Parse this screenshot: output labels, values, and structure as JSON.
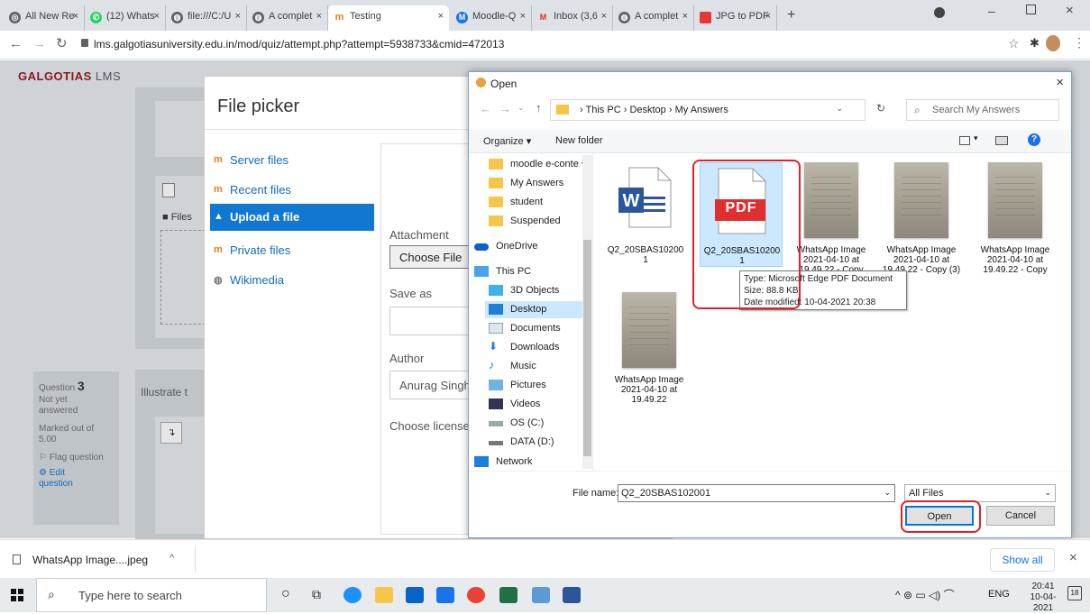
{
  "browser": {
    "tabs": [
      {
        "label": "All New Re",
        "icon": "chrome-icon",
        "color": "#5f6368"
      },
      {
        "label": "(12) Whats",
        "icon": "whatsapp-icon",
        "badge": "12",
        "color": "#25d366"
      },
      {
        "label": "file:///C:/U",
        "icon": "globe-icon",
        "color": "#5f6368"
      },
      {
        "label": "A complet",
        "icon": "globe-icon",
        "color": "#5f6368"
      },
      {
        "label": "Testing",
        "icon": "moodle-icon",
        "color": "#e77c1a",
        "active": true
      },
      {
        "label": "Moodle-Q",
        "icon": "moodle-icon",
        "color": "#1a73e8"
      },
      {
        "label": "Inbox (3,6",
        "icon": "gmail-icon",
        "color": "#d93025"
      },
      {
        "label": "A complet",
        "icon": "globe-icon",
        "color": "#5f6368"
      },
      {
        "label": "JPG to PDF",
        "icon": "jpg2pdf-icon",
        "color": "#e53935"
      }
    ],
    "address": "lms.galgotiasuniversity.edu.in/mod/quiz/attempt.php?attempt=5938733&cmid=472013"
  },
  "lms": {
    "logo_main": "GALGOTIAS",
    "logo_sub": "LMS",
    "files_label": "Files",
    "illustrate": "Illustrate t",
    "question": {
      "prefix": "Question",
      "number": "3",
      "status": "Not yet answered",
      "marked": "Marked out of 5.00",
      "flag": "Flag question",
      "edit": "Edit question"
    }
  },
  "file_picker": {
    "title": "File picker",
    "repos": [
      {
        "label": "Server files"
      },
      {
        "label": "Recent files"
      },
      {
        "label": "Upload a file",
        "active": true
      },
      {
        "label": "Private files"
      },
      {
        "label": "Wikimedia"
      }
    ],
    "attachment_label": "Attachment",
    "choose_file": "Choose File",
    "save_as_label": "Save as",
    "author_label": "Author",
    "author_value": "Anurag Singh",
    "license_label": "Choose license"
  },
  "dialog": {
    "title": "Open",
    "path": [
      "This PC",
      "Desktop",
      "My Answers"
    ],
    "search_placeholder": "Search My Answers",
    "organize": "Organize",
    "new_folder": "New folder",
    "nav_items": [
      {
        "label": "moodle e-conte",
        "icon": "folder-icon"
      },
      {
        "label": "My Answers",
        "icon": "folder-icon"
      },
      {
        "label": "student",
        "icon": "folder-icon"
      },
      {
        "label": "Suspended",
        "icon": "folder-icon"
      },
      {
        "label": "OneDrive",
        "icon": "cloud-icon"
      },
      {
        "label": "This PC",
        "icon": "pc-icon"
      },
      {
        "label": "3D Objects",
        "icon": "cube-icon"
      },
      {
        "label": "Desktop",
        "icon": "desktop-icon",
        "selected": true
      },
      {
        "label": "Documents",
        "icon": "document-icon"
      },
      {
        "label": "Downloads",
        "icon": "download-icon"
      },
      {
        "label": "Music",
        "icon": "music-icon"
      },
      {
        "label": "Pictures",
        "icon": "pictures-icon"
      },
      {
        "label": "Videos",
        "icon": "video-icon"
      },
      {
        "label": "OS (C:)",
        "icon": "drive-icon"
      },
      {
        "label": "DATA (D:)",
        "icon": "drive-icon"
      },
      {
        "label": "Network",
        "icon": "network-icon"
      }
    ],
    "files": [
      {
        "name": "Q2_20SBAS10200 1",
        "type": "word"
      },
      {
        "name": "Q2_20SBAS10200 1",
        "type": "pdf",
        "selected": true,
        "pdf_text": "PDF"
      },
      {
        "name": "WhatsApp Image 2021-04-10 at 19.49.22 - Copy",
        "type": "image"
      },
      {
        "name": "WhatsApp Image 2021-04-10 at 19.49.22 - Copy (3)",
        "type": "image"
      },
      {
        "name": "WhatsApp Image 2021-04-10 at 19.49.22 - Copy",
        "type": "image"
      },
      {
        "name": "WhatsApp Image 2021-04-10 at 19.49.22",
        "type": "image"
      }
    ],
    "tooltip": {
      "type": "Type: Microsoft Edge PDF Document",
      "size": "Size: 88.8 KB",
      "modified": "Date modified: 10-04-2021 20:38"
    },
    "file_name_label": "File name:",
    "file_name_value": "Q2_20SBAS102001",
    "file_type": "All Files",
    "open_label": "Open",
    "cancel_label": "Cancel"
  },
  "download_bar": {
    "item": "WhatsApp Image....jpeg",
    "show_all": "Show all"
  },
  "taskbar": {
    "search_placeholder": "Type here to search",
    "lang": "ENG",
    "time": "20:41",
    "date": "10-04-2021",
    "notifications": "18"
  },
  "colors": {
    "accent": "#1177d1",
    "highlight": "#e0202a",
    "pdf_red": "#e02f2f",
    "word_blue": "#2b579a"
  }
}
